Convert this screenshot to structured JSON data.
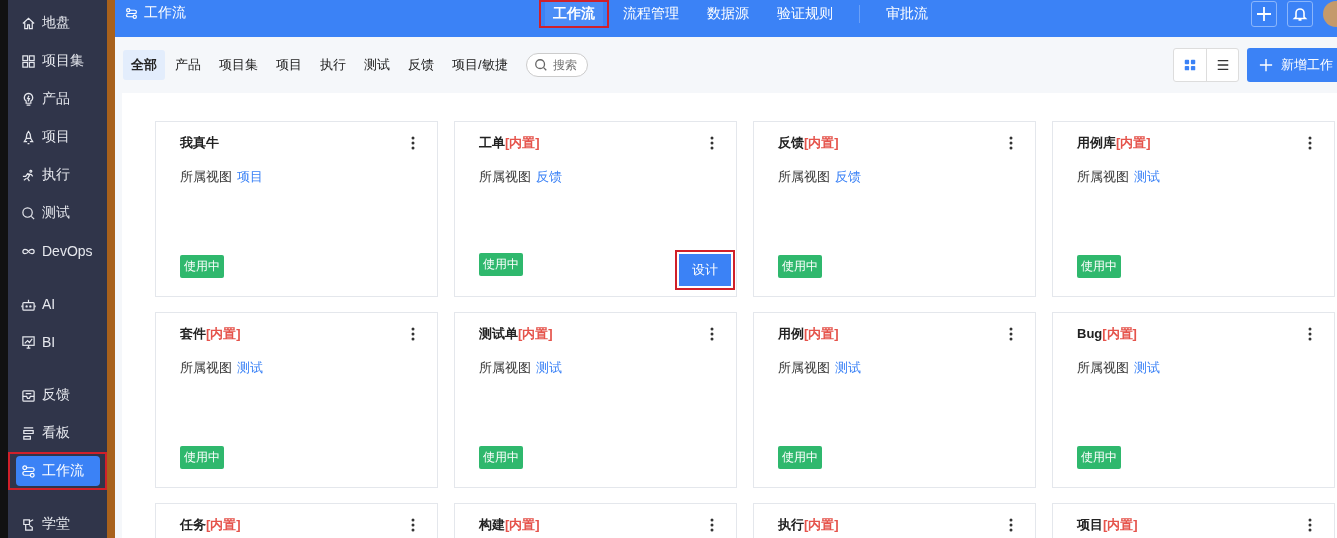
{
  "sidebar": {
    "groups": [
      [
        {
          "label": "地盘",
          "selected": false,
          "highlighted": false
        },
        {
          "label": "项目集",
          "selected": false,
          "highlighted": false
        },
        {
          "label": "产品",
          "selected": false,
          "highlighted": false
        },
        {
          "label": "项目",
          "selected": false,
          "highlighted": false
        },
        {
          "label": "执行",
          "selected": false,
          "highlighted": false
        },
        {
          "label": "测试",
          "selected": false,
          "highlighted": false
        },
        {
          "label": "DevOps",
          "selected": false,
          "highlighted": false
        }
      ],
      [
        {
          "label": "AI",
          "selected": false,
          "highlighted": false
        },
        {
          "label": "BI",
          "selected": false,
          "highlighted": false
        }
      ],
      [
        {
          "label": "反馈",
          "selected": false,
          "highlighted": false
        },
        {
          "label": "看板",
          "selected": false,
          "highlighted": false
        },
        {
          "label": "工作流",
          "selected": true,
          "highlighted": true
        }
      ],
      [
        {
          "label": "学堂",
          "selected": false,
          "highlighted": false
        }
      ]
    ]
  },
  "header": {
    "title": "工作流",
    "nav": [
      {
        "label": "工作流",
        "selected": true,
        "highlighted": true
      },
      {
        "label": "流程管理",
        "selected": false,
        "highlighted": false
      },
      {
        "label": "数据源",
        "selected": false,
        "highlighted": false
      },
      {
        "label": "验证规则",
        "selected": false,
        "highlighted": false
      },
      {
        "label": "审批流",
        "selected": false,
        "highlighted": false,
        "divider_before": true
      }
    ]
  },
  "filters": [
    {
      "label": "全部",
      "selected": true
    },
    {
      "label": "产品",
      "selected": false
    },
    {
      "label": "项目集",
      "selected": false
    },
    {
      "label": "项目",
      "selected": false
    },
    {
      "label": "执行",
      "selected": false
    },
    {
      "label": "测试",
      "selected": false
    },
    {
      "label": "反馈",
      "selected": false
    },
    {
      "label": "项目/敏捷",
      "selected": false
    }
  ],
  "search": {
    "placeholder": "搜索"
  },
  "view_toggle": [
    {
      "kind": "grid",
      "selected": true
    },
    {
      "kind": "list",
      "selected": false
    }
  ],
  "create_button": "新增工作",
  "cards": [
    {
      "name": "我真牛",
      "view_label": "所属视图",
      "view": "项目",
      "status": "使用中"
    },
    {
      "name": "工单",
      "tag": "[内置]",
      "view_label": "所属视图",
      "view": "反馈",
      "status": "使用中",
      "action": "设计",
      "action_highlighted": true
    },
    {
      "name": "反馈",
      "tag": "[内置]",
      "view_label": "所属视图",
      "view": "反馈",
      "status": "使用中"
    },
    {
      "name": "用例库",
      "tag": "[内置]",
      "view_label": "所属视图",
      "view": "测试",
      "status": "使用中"
    },
    {
      "name": "套件",
      "tag": "[内置]",
      "view_label": "所属视图",
      "view": "测试",
      "status": "使用中"
    },
    {
      "name": "测试单",
      "tag": "[内置]",
      "view_label": "所属视图",
      "view": "测试",
      "status": "使用中"
    },
    {
      "name": "用例",
      "tag": "[内置]",
      "view_label": "所属视图",
      "view": "测试",
      "status": "使用中"
    },
    {
      "name": "Bug",
      "tag": "[内置]",
      "view_label": "所属视图",
      "view": "测试",
      "status": "使用中"
    },
    {
      "name": "任务",
      "tag": "[内置]"
    },
    {
      "name": "构建",
      "tag": "[内置]"
    },
    {
      "name": "执行",
      "tag": "[内置]"
    },
    {
      "name": "项目",
      "tag": "[内置]"
    }
  ]
}
